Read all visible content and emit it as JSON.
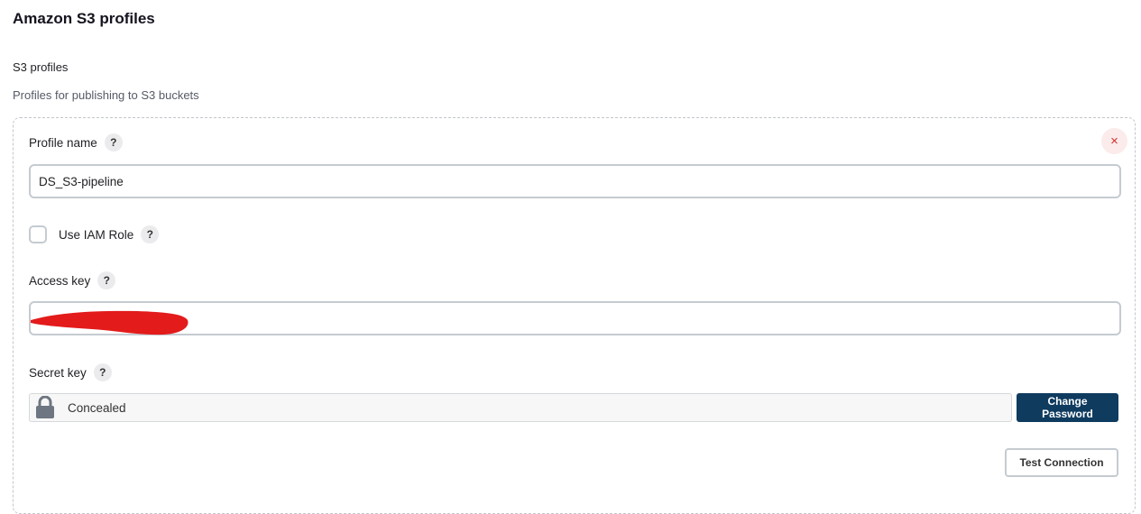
{
  "section": {
    "title": "Amazon S3 profiles"
  },
  "field": {
    "title": "S3 profiles",
    "description": "Profiles for publishing to S3 buckets"
  },
  "profile": {
    "close_symbol": "×",
    "name_label": "Profile name",
    "name_value": "DS_S3-pipeline",
    "iam_label": "Use IAM Role",
    "iam_checked": false,
    "access_key_label": "Access key",
    "access_key_value": "",
    "secret_key_label": "Secret key",
    "secret_key_status": "Concealed",
    "change_password_label": "Change Password",
    "test_connection_label": "Test Connection"
  },
  "help_symbol": "?",
  "colors": {
    "primary_button": "#0f3b5f",
    "close_icon": "#d32f2f",
    "redaction": "#e31b1b"
  },
  "icons": {
    "help": "help-icon",
    "close": "close-icon",
    "lock": "lock-icon"
  }
}
